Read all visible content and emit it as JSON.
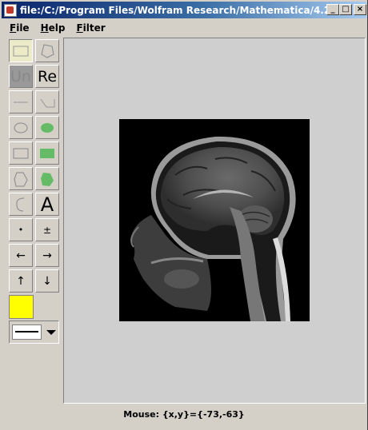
{
  "window": {
    "title": "file:/C:/Program Files/Wolfram Research/Mathematica/4.2/AddO...",
    "minimize_glyph": "_",
    "maximize_glyph": "□",
    "close_glyph": "×"
  },
  "menu": {
    "items": [
      {
        "label": "File"
      },
      {
        "label": "Help"
      },
      {
        "label": "Filter"
      }
    ]
  },
  "tools": {
    "undo_label": "Un",
    "redo_label": "Re",
    "text_label": "A",
    "point_label": "•",
    "plusminus_label": "±",
    "left_label": "←",
    "right_label": "→",
    "up_label": "↑",
    "down_label": "↓",
    "fill_color": "#ffff00",
    "shape_fill": "#66bb66"
  },
  "status": {
    "text": "Mouse: {x,y}={-73,-63}"
  }
}
